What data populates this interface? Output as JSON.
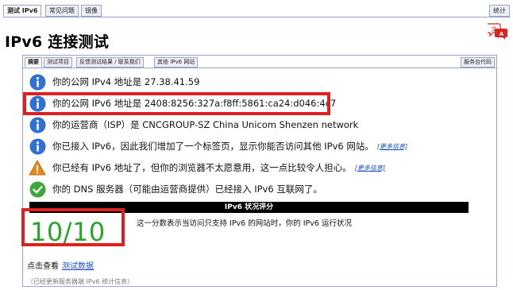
{
  "top_tabs": [
    {
      "label": "测试 IPv6",
      "active": true
    },
    {
      "label": "常见问题",
      "active": false
    },
    {
      "label": "镜像",
      "active": false
    }
  ],
  "stats_tab": "统计",
  "page_title": "IPv6 连接测试",
  "inner_tabs": [
    {
      "label": "摘要",
      "active": true
    },
    {
      "label": "测试项目",
      "active": false
    },
    {
      "label": "反馈测试结果 / 联系我们",
      "active": false
    },
    {
      "label": "其他 IPv6 网站",
      "active": false
    }
  ],
  "server_code_tab": "服务台代码",
  "status": [
    {
      "icon": "info-icon",
      "text": "你的公网 IPv4 地址是 27.38.41.59"
    },
    {
      "icon": "info-icon",
      "text": "你的公网 IPv6 地址是 2408:8256:327a:f8ff:5861:ca24:d046:4c7"
    },
    {
      "icon": "info-icon",
      "text": "你的运营商（ISP）是 CNCGROUP-SZ China Unicom Shenzen network"
    },
    {
      "icon": "info-icon",
      "text": "你已接入 IPv6，因此我们增加了一个标签页，显示你能否访问其他 IPv6 网站。",
      "more": "[更多信息]"
    },
    {
      "icon": "warning-icon",
      "text": "你已经有 IPv6 地址了，但你的浏览器不太愿意用，这一点比较令人担心。",
      "more": "[更多信息]"
    },
    {
      "icon": "check-icon",
      "text": "你的 DNS 服务器（可能由运营商提供）已经接入 IPv6 互联网了。"
    }
  ],
  "score": {
    "header": "IPv6 状况评分",
    "value": "10/10",
    "description": "这一分数表示当访问只支持 IPv6 的网站时，你的 IPv6 运行状况"
  },
  "test_data": {
    "prefix": "点击查看",
    "link": "测试数据"
  },
  "footnote": "（已经更新服务器端 IPv6 统计信息）",
  "colors": {
    "info": "#2f6fd6",
    "warning": "#e08a1e",
    "success": "#3aa93a",
    "score": "#2aa52a",
    "highlight": "#e02020",
    "link": "#1a4fc4"
  }
}
